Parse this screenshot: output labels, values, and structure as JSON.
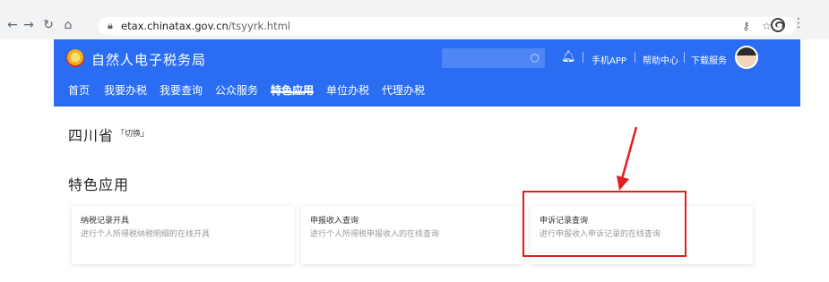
{
  "browser": {
    "url_host": "etax.chinatax.gov.cn",
    "url_path": "/tsyyrk.html"
  },
  "header": {
    "site_title": "自然人电子税务局",
    "links": [
      "手机APP",
      "帮助中心",
      "下载服务"
    ]
  },
  "nav": {
    "items": [
      "首页",
      "我要办税",
      "我要查询",
      "公众服务",
      "特色应用",
      "单位办税",
      "代理办税"
    ],
    "active_index": 4
  },
  "main": {
    "province": "四川省",
    "switch_label": "「切换」",
    "section_title": "特色应用",
    "cards": [
      {
        "title": "纳税记录开具",
        "desc": "进行个人所得税纳税明细的在线开具"
      },
      {
        "title": "申报收入查询",
        "desc": "进行个人所得税申报收入的在线查询"
      },
      {
        "title": "申诉记录查询",
        "desc": "进行申报收入申诉记录的在线查询"
      }
    ]
  },
  "annotation": {
    "color": "#e02020",
    "highlighted_card_index": 2
  }
}
